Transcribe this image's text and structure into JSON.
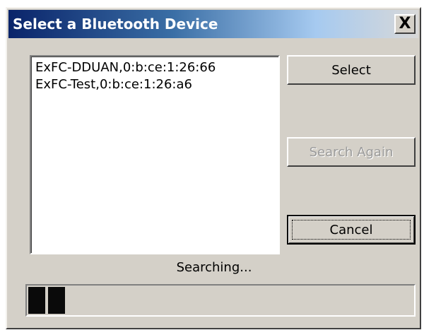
{
  "window": {
    "title": "Select a Bluetooth Device",
    "close_label": "X"
  },
  "device_list": {
    "items": [
      "ExFC-DDUAN,0:b:ce:1:26:66",
      "ExFC-Test,0:b:ce:1:26:a6"
    ]
  },
  "buttons": {
    "select": "Select",
    "search_again": "Search Again",
    "cancel": "Cancel"
  },
  "status": {
    "text": "Searching..."
  },
  "progress": {
    "filled_blocks": 2
  },
  "colors": {
    "title_bar_start": "#0a246a",
    "dialog_face": "#d4d0c8",
    "progress_block": "#0a0a0a"
  }
}
